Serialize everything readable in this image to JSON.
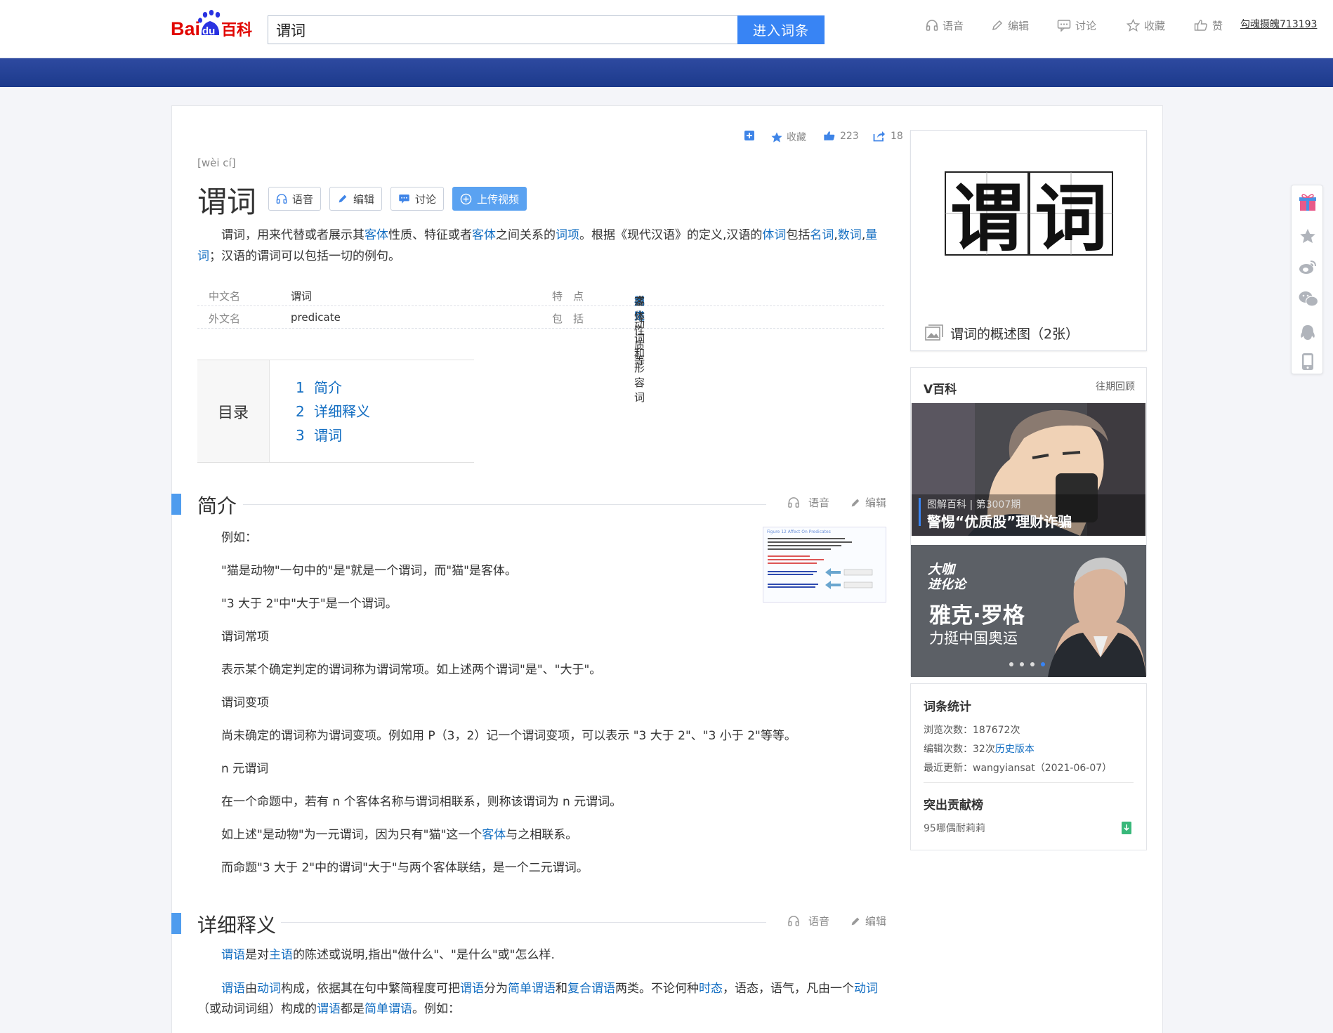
{
  "header": {
    "logo_text_bai": "Bai",
    "logo_text_du": "du",
    "logo_text_baike": "百科",
    "search_value": "谓词",
    "search_button": "进入词条",
    "nav": [
      {
        "label": "语音",
        "icon": "headphone-icon"
      },
      {
        "label": "编辑",
        "icon": "pencil-icon"
      },
      {
        "label": "讨论",
        "icon": "chat-icon"
      },
      {
        "label": "收藏",
        "icon": "star-icon"
      },
      {
        "label": "赞",
        "icon": "thumb-up-icon"
      }
    ],
    "user": "勾魂摄魄713193"
  },
  "toolbar_mini": {
    "favorite": "收藏",
    "likes": "223",
    "shares": "18"
  },
  "entry": {
    "pinyin": "[wèi cí]",
    "title": "谓词",
    "buttons": {
      "voice": "语音",
      "edit": "编辑",
      "discuss": "讨论",
      "upload": "上传视频"
    },
    "summary_parts": [
      {
        "t": "谓词，用来代替或者展示其",
        "link": false
      },
      {
        "t": "客体",
        "link": true
      },
      {
        "t": "性质、特征或者",
        "link": false
      },
      {
        "t": "客体",
        "link": true
      },
      {
        "t": "之间关系的",
        "link": false
      },
      {
        "t": "词项",
        "link": true
      },
      {
        "t": "。根据《现代汉语》的定义,汉语的",
        "link": false
      },
      {
        "t": "体词",
        "link": true
      },
      {
        "t": "包括",
        "link": false
      },
      {
        "t": "名词",
        "link": true
      },
      {
        "t": ",",
        "link": false
      },
      {
        "t": "数词",
        "link": true
      },
      {
        "t": ",",
        "link": false
      },
      {
        "t": "量词",
        "link": true
      },
      {
        "t": "；汉语的谓词可以包括一切的例句。",
        "link": false
      }
    ]
  },
  "infobox": {
    "rows": [
      {
        "k1": "中文名",
        "v1": "谓词",
        "k2": "特　点",
        "v2_parts": [
          {
            "t": "用来",
            "link": false
          },
          {
            "t": "描述",
            "link": true
          },
          {
            "t": "或",
            "link": false
          },
          {
            "t": "判定",
            "link": true
          },
          {
            "t": "客体性质等",
            "link": false
          }
        ]
      },
      {
        "k1": "外文名",
        "v1": "predicate",
        "k2": "包　括",
        "v2_parts": [
          {
            "t": "动词和形容词",
            "link": false
          }
        ]
      }
    ]
  },
  "toc": {
    "head": "目录",
    "items": [
      {
        "num": "1",
        "label": "简介"
      },
      {
        "num": "2",
        "label": "详细释义"
      },
      {
        "num": "3",
        "label": "谓词"
      }
    ]
  },
  "section_tools": {
    "voice": "语音",
    "edit": "编辑"
  },
  "section1": {
    "title": "简介",
    "paras": [
      "例如：",
      "\"猫是动物\"一句中的\"是\"就是一个谓词，而\"猫\"是客体。",
      "\"3 大于 2\"中\"大于\"是一个谓词。",
      "谓词常项",
      "表示某个确定判定的谓词称为谓词常项。如上述两个谓词\"是\"、\"大于\"。",
      "谓词变项",
      "尚未确定的谓词称为谓词变项。例如用 P（3，2）记一个谓词变项，可以表示 \"3 大于 2\"、\"3 小于 2\"等等。",
      "n 元谓词",
      "在一个命题中，若有 n 个客体名称与谓词相联系，则称该谓词为 n 元谓词。"
    ],
    "para_link": {
      "before": "如上述\"是动物\"为一元谓词，因为只有\"猫\"这一个",
      "link": "客体",
      "after": "与之相联系。"
    },
    "para_last": "而命题\"3 大于 2\"中的谓词\"大于\"与两个客体联结，是一个二元谓词。"
  },
  "section2": {
    "title": "详细释义",
    "p1": [
      {
        "t": "谓语",
        "link": true
      },
      {
        "t": "是对",
        "link": false
      },
      {
        "t": "主语",
        "link": true
      },
      {
        "t": "的陈述或说明,指出\"做什么\"、\"是什么\"或\"怎么样.",
        "link": false
      }
    ],
    "p2": [
      {
        "t": "谓语",
        "link": true
      },
      {
        "t": "由",
        "link": false
      },
      {
        "t": "动词",
        "link": true
      },
      {
        "t": "构成，依据其在句中繁简程度可把",
        "link": false
      },
      {
        "t": "谓语",
        "link": true
      },
      {
        "t": "分为",
        "link": false
      },
      {
        "t": "简单谓语",
        "link": true
      },
      {
        "t": "和",
        "link": false
      },
      {
        "t": "复合谓语",
        "link": true
      },
      {
        "t": "两类。不论何种",
        "link": false
      },
      {
        "t": "时态",
        "link": true
      },
      {
        "t": "，语态，语气，凡由一个",
        "link": false
      },
      {
        "t": "动词",
        "link": true
      },
      {
        "t": "（或动词词组）构成的",
        "link": false
      },
      {
        "t": "谓语",
        "link": true
      },
      {
        "t": "都是",
        "link": false
      },
      {
        "t": "简单谓语",
        "link": true
      },
      {
        "t": "。例如：",
        "link": false
      }
    ]
  },
  "thumb": {
    "caption": "Figure 12 Affect On Predicates"
  },
  "sidebar": {
    "pic_chars": [
      "谓",
      "词"
    ],
    "pic_caption": "谓词的概述图（2张）",
    "v_title": "V百科",
    "v_more": "往期回顾",
    "v1_small": "图解百科 | 第3007期",
    "v1_big": "警惕“优质股”理财诈骗",
    "v2_logo_top": "大咖",
    "v2_logo_bottom": "进化论",
    "v2_name": "雅克·罗格",
    "v2_sub": "力挺中国奥运",
    "stats_title": "词条统计",
    "views": "浏览次数：187672次",
    "edits_prefix": "编辑次数：32次",
    "edits_link": "历史版本",
    "last_update": "最近更新：wangyiansat（2021-06-07）",
    "contrib_title": "突出贡献榜",
    "contributor": "95哪偶耐莉莉"
  },
  "colors": {
    "accent": "#3884f4",
    "link": "#136ec2",
    "header_band": "#1c3a8c",
    "section_bar": "#4f9cee"
  }
}
